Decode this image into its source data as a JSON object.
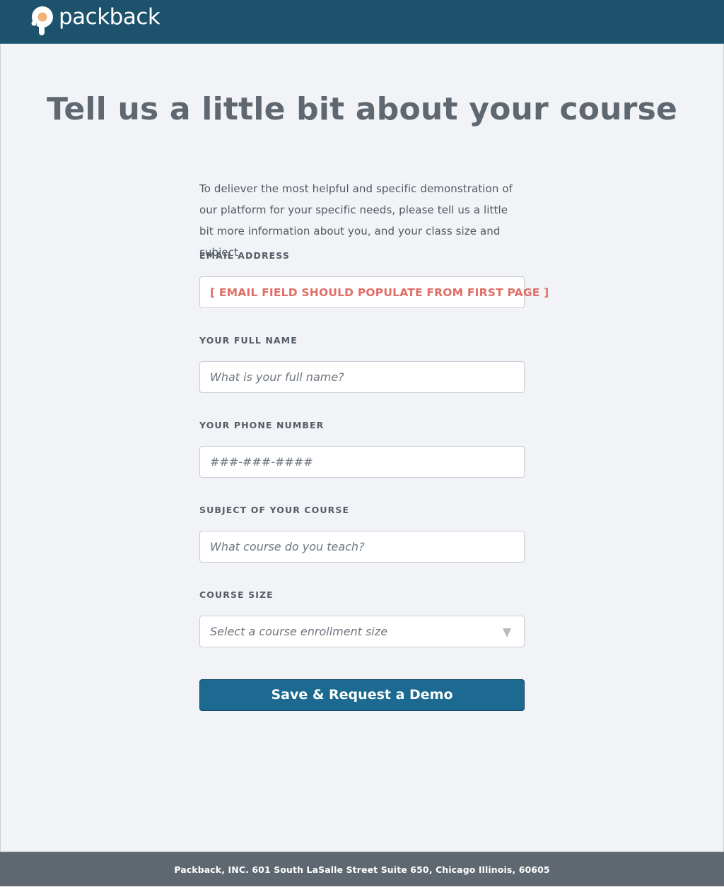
{
  "header": {
    "brand": "packback",
    "colors": {
      "bar": "#1c526c",
      "logo_accent": "#f2b37a"
    }
  },
  "main": {
    "title": "Tell us a little bit about your course",
    "intro": "To deliever the most helpful and specific demonstration of our platform for your specific needs, please tell us a little bit more information about you, and your class size and subject.",
    "fields": {
      "email": {
        "label": "EMAIL ADDRESS",
        "value": "[ EMAIL FIELD SHOULD POPULATE FROM FIRST PAGE ]"
      },
      "full_name": {
        "label": "YOUR FULL NAME",
        "placeholder": "What is your full name?"
      },
      "phone": {
        "label": "YOUR PHONE NUMBER",
        "placeholder": "###-###-####"
      },
      "subject": {
        "label": "SUBJECT OF YOUR COURSE",
        "placeholder": "What course do you teach?"
      },
      "course_size": {
        "label": "COURSE SIZE",
        "selected": "Select a course enrollment size"
      }
    },
    "submit_label": "Save & Request a Demo",
    "colors": {
      "email_value": "#e06e66",
      "button": "#1c6a91"
    }
  },
  "footer": {
    "text": "Packback, INC.  601 South LaSalle Street Suite 650, Chicago Illinois, 60605"
  }
}
